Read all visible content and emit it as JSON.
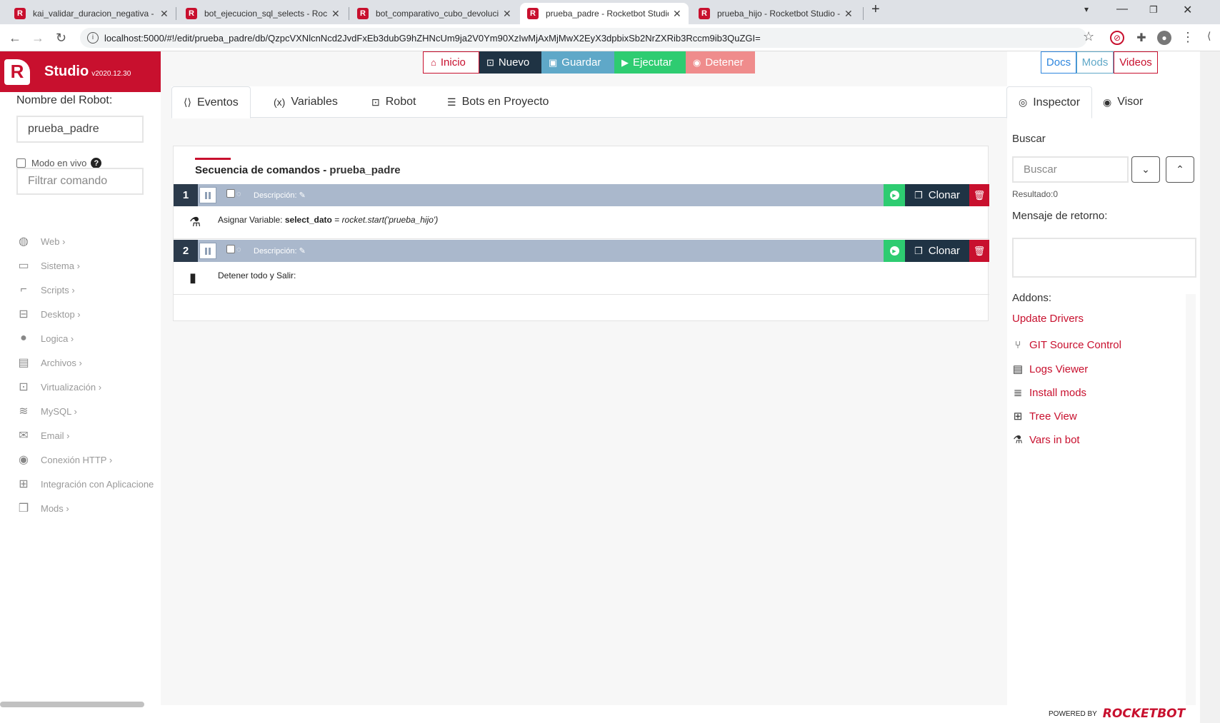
{
  "browser": {
    "tabs": [
      {
        "title": "kai_validar_duracion_negativa - R"
      },
      {
        "title": "bot_ejecucion_sql_selects - Rocke"
      },
      {
        "title": "bot_comparativo_cubo_devolucio"
      },
      {
        "title": "prueba_padre - Rocketbot Studio"
      },
      {
        "title": "prueba_hijo - Rocketbot Studio -"
      }
    ],
    "url": "localhost:5000/#!/edit/prueba_padre/db/QzpcVXNlcnNcd2JvdFxEb3dubG9hZHNcUm9ja2V0Ym90XzIwMjAxMjMwX2EyX3dpbixSb2NrZXRib3Rccm9ib3QuZGI="
  },
  "brand": {
    "name": "Studio",
    "version": "v2020.12.30"
  },
  "sidebar": {
    "robot_label": "Nombre del Robot:",
    "robot_name": "prueba_padre",
    "live_mode": "Modo en vivo",
    "filter_placeholder": "Filtrar comando",
    "categories": [
      {
        "label": "Web ›",
        "icon": "globe-icon"
      },
      {
        "label": "Sistema ›",
        "icon": "monitor-icon"
      },
      {
        "label": "Scripts ›",
        "icon": "script-icon"
      },
      {
        "label": "Desktop ›",
        "icon": "desktop-search-icon"
      },
      {
        "label": "Logica ›",
        "icon": "lightbulb-icon"
      },
      {
        "label": "Archivos ›",
        "icon": "file-icon"
      },
      {
        "label": "Virtualización ›",
        "icon": "virtual-icon"
      },
      {
        "label": "MySQL ›",
        "icon": "database-icon"
      },
      {
        "label": "Email ›",
        "icon": "envelope-icon"
      },
      {
        "label": "Conexión HTTP ›",
        "icon": "broadcast-icon"
      },
      {
        "label": "Integración con Aplicacione",
        "icon": "windows-icon"
      },
      {
        "label": "Mods ›",
        "icon": "mods-icon"
      }
    ]
  },
  "toolbar": {
    "inicio": "Inicio",
    "nuevo": "Nuevo",
    "guardar": "Guardar",
    "ejecutar": "Ejecutar",
    "detener": "Detener",
    "docs": "Docs",
    "mods": "Mods",
    "videos": "Videos"
  },
  "tabs": {
    "eventos": "Eventos",
    "variables": "Variables",
    "robot": "Robot",
    "bots": "Bots en Proyecto",
    "inspector": "Inspector",
    "visor": "Visor"
  },
  "sequence": {
    "title": "Secuencia de comandos",
    "bot": "prueba_padre",
    "commands": [
      {
        "num": "1",
        "desc": "Descripción:",
        "clone": "Clonar",
        "label": "Asignar Variable:",
        "var": "select_dato",
        "eq": " = ",
        "value": "rocket.start('prueba_hijo')"
      },
      {
        "num": "2",
        "desc": "Descripción:",
        "clone": "Clonar",
        "label": "Detener todo y Salir:"
      }
    ]
  },
  "inspector": {
    "search_label": "Buscar",
    "search_placeholder": "Buscar",
    "result": "Resultado:0",
    "return_label": "Mensaje de retorno:",
    "addons_label": "Addons:",
    "update_drivers": "Update Drivers",
    "addons": [
      {
        "label": "GIT Source Control",
        "icon": "git-branch-icon"
      },
      {
        "label": "Logs Viewer",
        "icon": "log-icon"
      },
      {
        "label": "Install mods",
        "icon": "install-icon"
      },
      {
        "label": "Tree View",
        "icon": "tree-icon"
      },
      {
        "label": "Vars in bot",
        "icon": "flask-icon"
      }
    ]
  },
  "footer": {
    "powered": "POWERED BY",
    "brand": "ROCKETBOT"
  },
  "colors": {
    "brand": "#c8102e",
    "green": "#2ecc71",
    "navy": "#1f3344",
    "cmdbar": "#aab8cc"
  }
}
